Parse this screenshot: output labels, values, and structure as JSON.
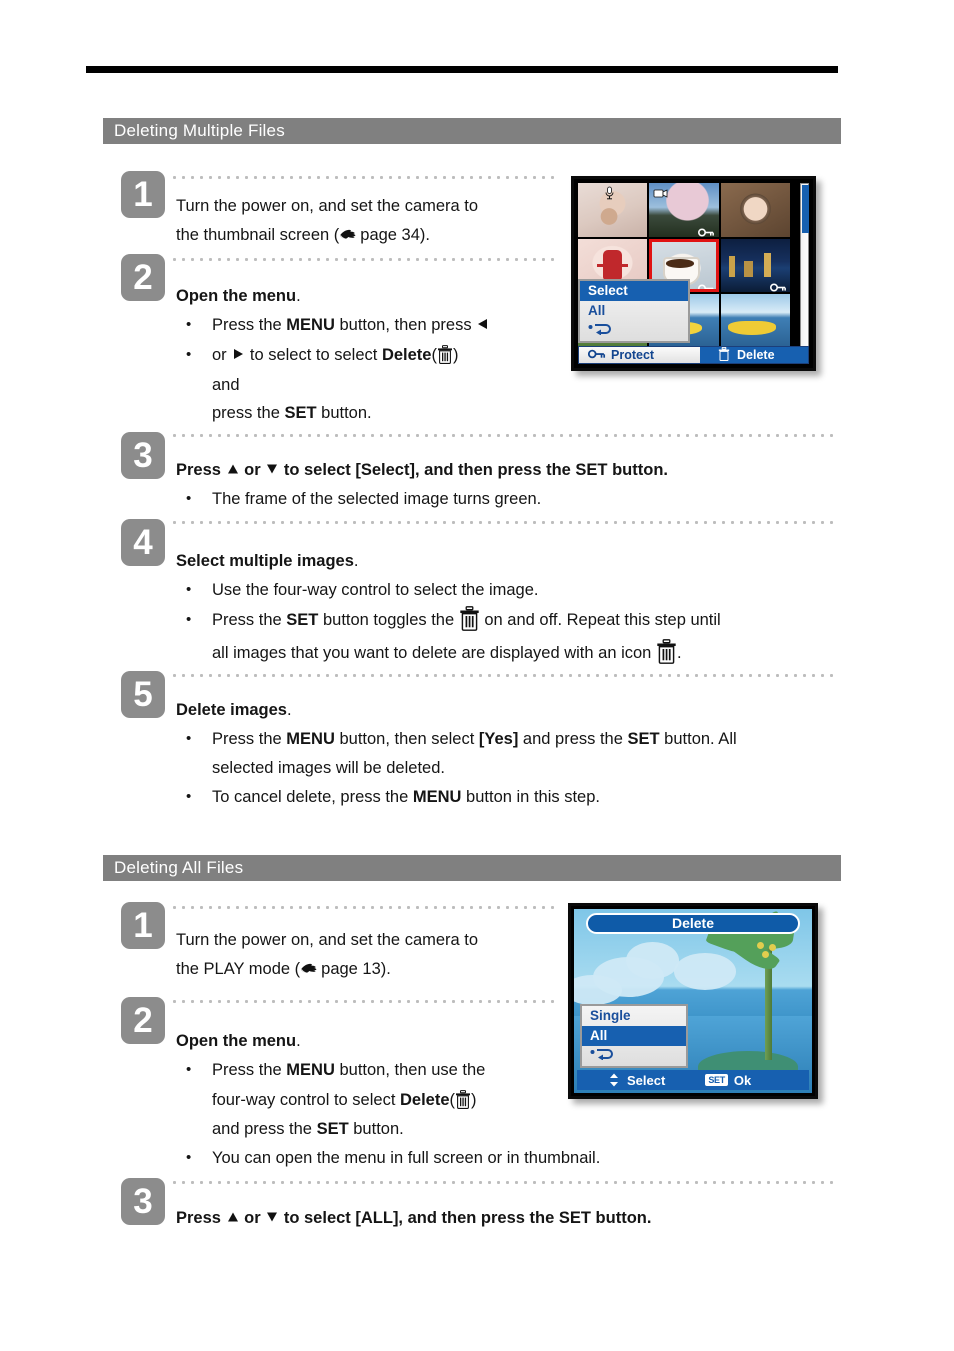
{
  "sections": [
    {
      "id": "multiple",
      "heading": "Deleting Multiple Files",
      "steps": [
        {
          "number": "1",
          "title": "Turn the power on, and set the camera to",
          "title2": "the thumbnail screen (",
          "ref": "page 34",
          "title3": ")."
        },
        {
          "number": "2",
          "title": "Open the menu",
          "title_period": ".",
          "bullets": [
            "Press the MENU button, then press",
            "or  to select to select Delete (  )",
            "and",
            "press the SET button."
          ]
        },
        {
          "number": "3",
          "title": "Press  or  to select [Select], and then press the SET button.",
          "bullets": [
            "The frame of the selected image turns green."
          ]
        },
        {
          "number": "4",
          "title": "Select multiple images",
          "title_period": ".",
          "bullets": [
            "Use the four-way control to select the image.",
            "Press the SET button toggles the   on and off. Repeat this step until",
            "all images that you want to delete are displayed with an icon  ."
          ]
        },
        {
          "number": "5",
          "title": "Delete images",
          "title_period": ".",
          "bullets": [
            "Press the MENU button, then select [Yes] and press the SET button. All",
            "selected images will be deleted.",
            "To cancel delete, press the MENU button in this step."
          ]
        }
      ]
    },
    {
      "id": "all",
      "heading": "Deleting All Files",
      "steps": [
        {
          "number": "1",
          "title": "Turn the power on, and set the camera to",
          "title2": "the PLAY mode (",
          "ref": "page 13",
          "title3": ")."
        },
        {
          "number": "2",
          "title": "Open the menu",
          "title_period": ".",
          "bullets": [
            "Press the MENU button, then use the",
            "four-way control to select Delete (  )",
            "and press the SET button.",
            "You can open the menu in full screen or in thumbnail."
          ]
        },
        {
          "number": "3",
          "title": "Press  or  to select [ALL], and then press the SET button."
        }
      ]
    }
  ],
  "text": {
    "s1_step1_l1": "Turn the power on, and set the camera to",
    "s1_step1_l2a": "the thumbnail screen (",
    "s1_step1_ref": "page 34",
    "s1_step1_l2b": ").",
    "s1_step2_title": "Open the menu",
    "period": ".",
    "s1_step2_b1a": "Press the ",
    "menu_word": "MENU",
    "s1_step2_b1b": " button, then press",
    "s1_step2_b2a": "or",
    "s1_step2_b2b": "to select to select ",
    "delete_word": "Delete",
    "paren_open": "(",
    "paren_close": ")",
    "s1_step2_b3": "and",
    "s1_step2_b4a": "press the ",
    "set_word": "SET",
    "s1_step2_b4b": " button.",
    "s1_step3_a": "Press",
    "s1_step3_b": "or",
    "s1_step3_c": "to select [Select], and then press the SET button.",
    "s1_step3_bullet": "The frame of the selected image turns green.",
    "s1_step4_title": "Select multiple images",
    "s1_step4_b1": "Use the four-way control to select the image.",
    "s1_step4_b2a": "Press the ",
    "s1_step4_b2b": " button toggles the",
    "s1_step4_b2c": "on and off. Repeat this step until",
    "s1_step4_b3a": "all images that you want to delete are displayed with an icon",
    "s1_step4_b3b": ".",
    "s1_step5_title": "Delete images",
    "s1_step5_b1a": "Press the ",
    "s1_step5_b1b": " button, then select ",
    "yes_word": "[Yes]",
    "s1_step5_b1c": " and press the ",
    "s1_step5_b1d": " button. All",
    "s1_step5_b2": "selected images will be deleted.",
    "s1_step5_b3a": "To cancel delete, press the ",
    "s1_step5_b3b": " button in this step.",
    "s2_step1_l1": "Turn the power on, and set the camera to",
    "s2_step1_l2a": "the PLAY mode (",
    "s2_step1_ref": "page 13",
    "s2_step1_l2b": ").",
    "s2_step2_title": "Open the menu",
    "s2_step2_b1a": "Press the ",
    "s2_step2_b1b": " button, then use the",
    "s2_step2_b2a": "four-way control to select ",
    "s2_step2_b3a": "and press the ",
    "s2_step2_b3b": " button.",
    "s2_step2_b4": "You can open the menu in full screen or in thumbnail.",
    "s2_step3_a": "Press",
    "s2_step3_b": "or",
    "s2_step3_c": "to select [ALL], and then press the SET button."
  },
  "camera_thumbnail_screen": {
    "menu": {
      "items": [
        "Select",
        "All"
      ],
      "selected": "Select",
      "back_label": "back-arrow"
    },
    "statusbar": {
      "protect_label": "Protect",
      "delete_label": "Delete",
      "protect_icon": "key-icon",
      "delete_icon": "trash-icon"
    },
    "thumbnails": [
      {
        "name": "baby",
        "badge": "mic-icon"
      },
      {
        "name": "cherry-tree",
        "badge": "video-icon",
        "badge2": "key-icon"
      },
      {
        "name": "girls-portrait",
        "badge": ""
      },
      {
        "name": "microphone-red",
        "badge": ""
      },
      {
        "name": "coffee-cup",
        "badge": "key-icon",
        "selected": true
      },
      {
        "name": "city-night",
        "badge": "key-icon"
      },
      {
        "name": "flower-field",
        "badge": ""
      },
      {
        "name": "boat-ride",
        "badge": ""
      }
    ]
  },
  "camera_beach_screen": {
    "title": "Delete",
    "menu": {
      "items": [
        "Single",
        "All"
      ],
      "selected": "All",
      "back_label": "back-arrow"
    },
    "statusbar": {
      "select_label": "Select",
      "ok_label": "Ok",
      "set_key": "SET",
      "updown_icon": "up-down-arrow-icon"
    }
  },
  "colors": {
    "section_bar": "#808080",
    "badge": "#8c8c8c",
    "camera_blue": "#1760b0",
    "selected_frame": "#e01313",
    "rule": "#000000"
  }
}
